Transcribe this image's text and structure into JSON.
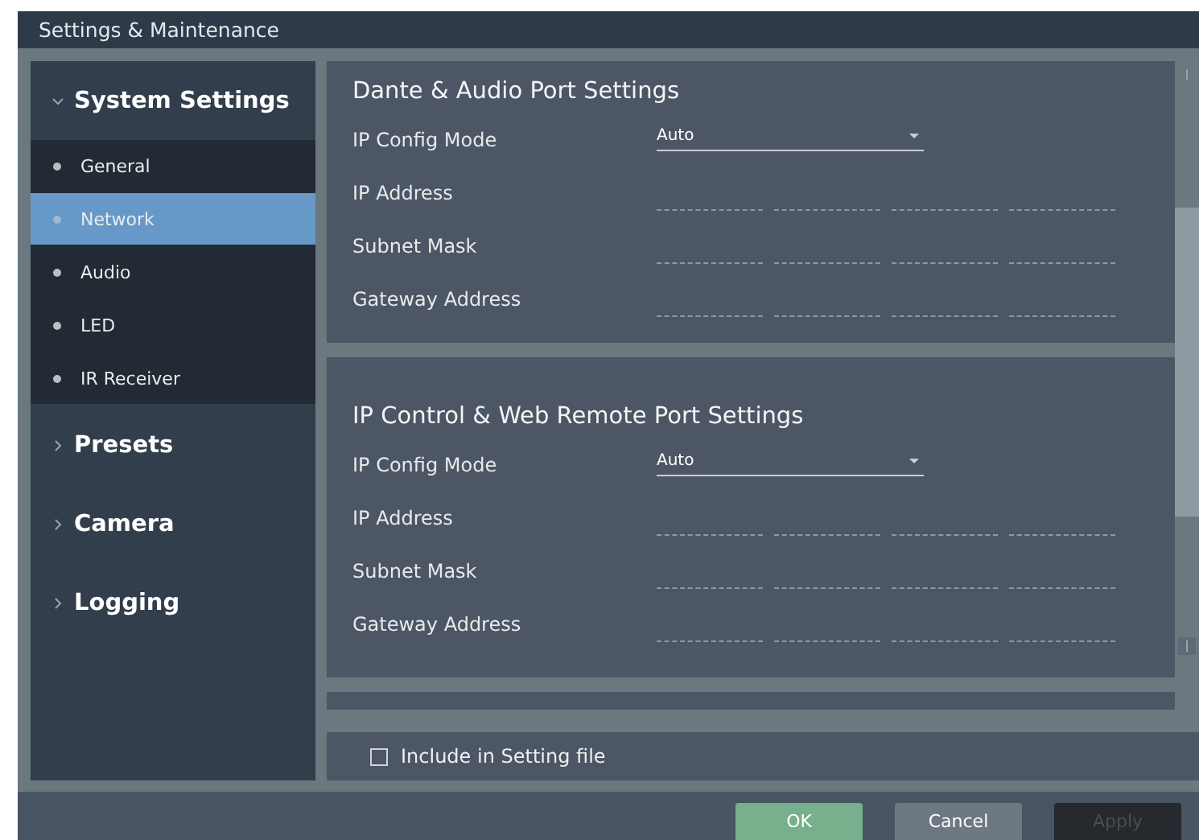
{
  "window": {
    "title": "Settings & Maintenance"
  },
  "sidebar": {
    "groups": [
      {
        "label": "System Settings",
        "expanded": true,
        "items": [
          {
            "label": "General",
            "selected": false
          },
          {
            "label": "Network",
            "selected": true
          },
          {
            "label": "Audio",
            "selected": false
          },
          {
            "label": "LED",
            "selected": false
          },
          {
            "label": "IR Receiver",
            "selected": false
          }
        ]
      },
      {
        "label": "Presets",
        "expanded": false
      },
      {
        "label": "Camera",
        "expanded": false
      },
      {
        "label": "Logging",
        "expanded": false
      }
    ]
  },
  "sections": [
    {
      "title": "Dante & Audio Port Settings",
      "fields": [
        {
          "label": "IP Config Mode",
          "kind": "select",
          "value": "Auto"
        },
        {
          "label": "IP Address",
          "kind": "ip"
        },
        {
          "label": "Subnet Mask",
          "kind": "ip"
        },
        {
          "label": "Gateway Address",
          "kind": "ip"
        }
      ]
    },
    {
      "title": "IP Control & Web Remote Port Settings",
      "fields": [
        {
          "label": "IP Config Mode",
          "kind": "select",
          "value": "Auto"
        },
        {
          "label": "IP Address",
          "kind": "ip"
        },
        {
          "label": "Subnet Mask",
          "kind": "ip"
        },
        {
          "label": "Gateway Address",
          "kind": "ip"
        }
      ]
    }
  ],
  "include_checkbox": {
    "label": "Include in Setting file",
    "checked": false
  },
  "buttons": [
    {
      "label": "OK",
      "kind": "primary",
      "disabled": false
    },
    {
      "label": "Cancel",
      "kind": "secondary",
      "disabled": false
    },
    {
      "label": "Apply",
      "kind": "secondary",
      "disabled": true
    }
  ]
}
